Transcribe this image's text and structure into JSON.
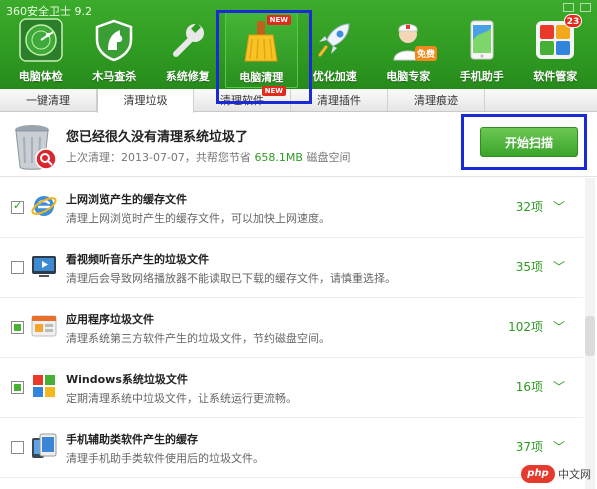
{
  "window": {
    "title": "360安全卫士 9.2"
  },
  "nav": {
    "items": [
      {
        "label": "电脑体检",
        "icon": "radar-icon"
      },
      {
        "label": "木马查杀",
        "icon": "horse-shield-icon"
      },
      {
        "label": "系统修复",
        "icon": "wrench-icon"
      },
      {
        "label": "电脑清理",
        "icon": "broom-icon",
        "badge": "NEW"
      },
      {
        "label": "优化加速",
        "icon": "rocket-icon"
      },
      {
        "label": "电脑专家",
        "icon": "expert-icon",
        "badge": "免费"
      },
      {
        "label": "手机助手",
        "icon": "phone-icon"
      },
      {
        "label": "软件管家",
        "icon": "software-grid-icon",
        "badge": "23"
      }
    ]
  },
  "tabs": [
    {
      "label": "一键清理"
    },
    {
      "label": "清理垃圾"
    },
    {
      "label": "清理软件",
      "badge": "NEW"
    },
    {
      "label": "清理插件"
    },
    {
      "label": "清理痕迹"
    }
  ],
  "summary": {
    "title": "您已经很久没有清理系统垃圾了",
    "last_prefix": "上次清理：2013-07-07，共帮您节省 ",
    "saved": "658.1MB",
    "suffix": " 磁盘空间",
    "scan_button": "开始扫描"
  },
  "items": [
    {
      "title": "上网浏览产生的缓存文件",
      "desc": "清理上网浏览时产生的缓存文件，可以加快上网速度。",
      "count": "32项",
      "state": "checked",
      "icon": "ie-browser-icon"
    },
    {
      "title": "看视频听音乐产生的垃圾文件",
      "desc": "清理后会导致网络播放器不能读取已下载的缓存文件，请慎重选择。",
      "count": "35项",
      "state": "unchecked",
      "icon": "video-player-icon"
    },
    {
      "title": "应用程序垃圾文件",
      "desc": "清理系统第三方软件产生的垃圾文件，节约磁盘空间。",
      "count": "102项",
      "state": "partial",
      "icon": "application-icon"
    },
    {
      "title": "Windows系统垃圾文件",
      "desc": "定期清理系统中垃圾文件，让系统运行更流畅。",
      "count": "16项",
      "state": "partial",
      "icon": "windows-logo-icon"
    },
    {
      "title": "手机辅助类软件产生的缓存",
      "desc": "清理手机助手类软件使用后的垃圾文件。",
      "count": "37项",
      "state": "unchecked",
      "icon": "mobile-device-icon"
    }
  ],
  "watermark": {
    "logo": "php",
    "text": "中文网"
  },
  "colors": {
    "brand_green": "#2f9a22",
    "highlight_blue": "#1a2bd6"
  }
}
